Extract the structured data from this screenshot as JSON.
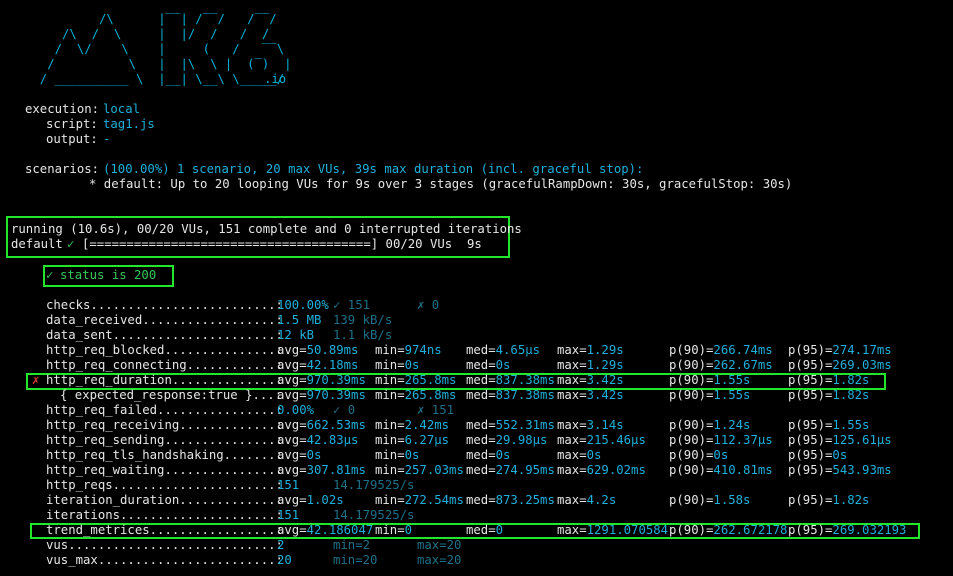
{
  "colors": {
    "background": "#000000",
    "text": "#e6e6e6",
    "cyan": "#1fb0d9",
    "dim_cyan": "#1e6f87",
    "highlight_box": "#22e62b",
    "check_green": "#34c759",
    "fail_red": "#e23b3b"
  },
  "logo": {
    "lines": [
      "          /\\      |‾‾| /‾‾/   /‾‾/",
      "     /\\  /  \\     |  |/  /   /  /",
      "    /  \\/    \\    |     (   /   ‾‾\\",
      "   /          \\   |  |\\  \\ |  (‾)  |",
      "  / __________ \\  |__| \\__\\ \\_____/"
    ],
    "suffix": ".io"
  },
  "execution": {
    "execution_label": "execution:",
    "execution_value": "local",
    "script_label": "script:",
    "script_value": "tag1.js",
    "output_label": "output:",
    "output_value": "-"
  },
  "scenarios": {
    "label": "scenarios:",
    "summary": "(100.00%) 1 scenario, 20 max VUs, 39s max duration (incl. graceful stop):",
    "detail": "* default: Up to 20 looping VUs for 9s over 3 stages (gracefulRampDown: 30s, gracefulStop: 30s)"
  },
  "run_status": {
    "line1": "running (10.6s), 00/20 VUs, 151 complete and 0 interrupted iterations",
    "name": "default",
    "check": "✓",
    "progress": "[======================================] 00/20 VUs  9s"
  },
  "check_result": {
    "mark": "✓",
    "text": "status is 200"
  },
  "metrics": [
    {
      "name": "checks",
      "dots": "checks.........................:",
      "cols": [
        {
          "text": "100.00%",
          "style": "cyan"
        },
        {
          "text": "✓ 151",
          "style": "dim"
        },
        {
          "text": "✗ 0",
          "style": "dim"
        }
      ]
    },
    {
      "name": "data_received",
      "dots": "data_received..................:",
      "cols": [
        {
          "text": "1.5 MB",
          "style": "cyan"
        },
        {
          "text": "139 kB/s",
          "style": "dim"
        }
      ]
    },
    {
      "name": "data_sent",
      "dots": "data_sent......................:",
      "cols": [
        {
          "text": "12 kB",
          "style": "cyan"
        },
        {
          "text": "1.1 kB/s",
          "style": "dim"
        }
      ]
    },
    {
      "name": "http_req_blocked",
      "dots": "http_req_blocked...............:",
      "trend": [
        "avg=50.89ms",
        "min=974ns",
        "med=4.65µs",
        "max=1.29s",
        "p(90)=266.74ms",
        "p(95)=274.17ms"
      ]
    },
    {
      "name": "http_req_connecting",
      "dots": "http_req_connecting............:",
      "trend": [
        "avg=42.18ms",
        "min=0s",
        "med=0s",
        "max=1.29s",
        "p(90)=262.67ms",
        "p(95)=269.03ms"
      ]
    },
    {
      "name": "http_req_duration",
      "dots": "http_req_duration..............:",
      "fail": "✗",
      "trend": [
        "avg=970.39ms",
        "min=265.8ms",
        "med=837.38ms",
        "max=3.42s",
        "p(90)=1.55s",
        "p(95)=1.82s"
      ]
    },
    {
      "name": "expected_response",
      "dots": "{ expected_response:true }...:",
      "indent": true,
      "trend": [
        "avg=970.39ms",
        "min=265.8ms",
        "med=837.38ms",
        "max=3.42s",
        "p(90)=1.55s",
        "p(95)=1.82s"
      ]
    },
    {
      "name": "http_req_failed",
      "dots": "http_req_failed................:",
      "cols": [
        {
          "text": "0.00%",
          "style": "cyan"
        },
        {
          "text": "✓ 0",
          "style": "dim"
        },
        {
          "text": "✗ 151",
          "style": "dim"
        }
      ]
    },
    {
      "name": "http_req_receiving",
      "dots": "http_req_receiving.............:",
      "trend": [
        "avg=662.53ms",
        "min=2.42ms",
        "med=552.31ms",
        "max=3.14s",
        "p(90)=1.24s",
        "p(95)=1.55s"
      ]
    },
    {
      "name": "http_req_sending",
      "dots": "http_req_sending...............:",
      "trend": [
        "avg=42.83µs",
        "min=6.27µs",
        "med=29.98µs",
        "max=215.46µs",
        "p(90)=112.37µs",
        "p(95)=125.61µs"
      ]
    },
    {
      "name": "http_req_tls_handshaking",
      "dots": "http_req_tls_handshaking.......:",
      "trend": [
        "avg=0s",
        "min=0s",
        "med=0s",
        "max=0s",
        "p(90)=0s",
        "p(95)=0s"
      ]
    },
    {
      "name": "http_req_waiting",
      "dots": "http_req_waiting...............:",
      "trend": [
        "avg=307.81ms",
        "min=257.03ms",
        "med=274.95ms",
        "max=629.02ms",
        "p(90)=410.81ms",
        "p(95)=543.93ms"
      ]
    },
    {
      "name": "http_reqs",
      "dots": "http_reqs......................:",
      "cols": [
        {
          "text": "151",
          "style": "cyan"
        },
        {
          "text": "14.179525/s",
          "style": "dim"
        }
      ]
    },
    {
      "name": "iteration_duration",
      "dots": "iteration_duration.............:",
      "trend": [
        "avg=1.02s",
        "min=272.54ms",
        "med=873.25ms",
        "max=4.2s",
        "p(90)=1.58s",
        "p(95)=1.82s"
      ]
    },
    {
      "name": "iterations",
      "dots": "iterations.....................:",
      "cols": [
        {
          "text": "151",
          "style": "cyan"
        },
        {
          "text": "14.179525/s",
          "style": "dim"
        }
      ]
    },
    {
      "name": "trend_metrices",
      "dots": "trend_metrices.................:",
      "trend": [
        "avg=42.186047",
        "min=0",
        "med=0",
        "max=1291.070584",
        "p(90)=262.672178",
        "p(95)=269.032193"
      ]
    },
    {
      "name": "vus",
      "dots": "vus............................:",
      "cols": [
        {
          "text": "2",
          "style": "cyan"
        },
        {
          "text": "min=2",
          "style": "dim"
        },
        {
          "text": "max=20",
          "style": "dim"
        }
      ]
    },
    {
      "name": "vus_max",
      "dots": "vus_max........................:",
      "cols": [
        {
          "text": "20",
          "style": "cyan"
        },
        {
          "text": "min=20",
          "style": "dim"
        },
        {
          "text": "max=20",
          "style": "dim"
        }
      ]
    }
  ]
}
